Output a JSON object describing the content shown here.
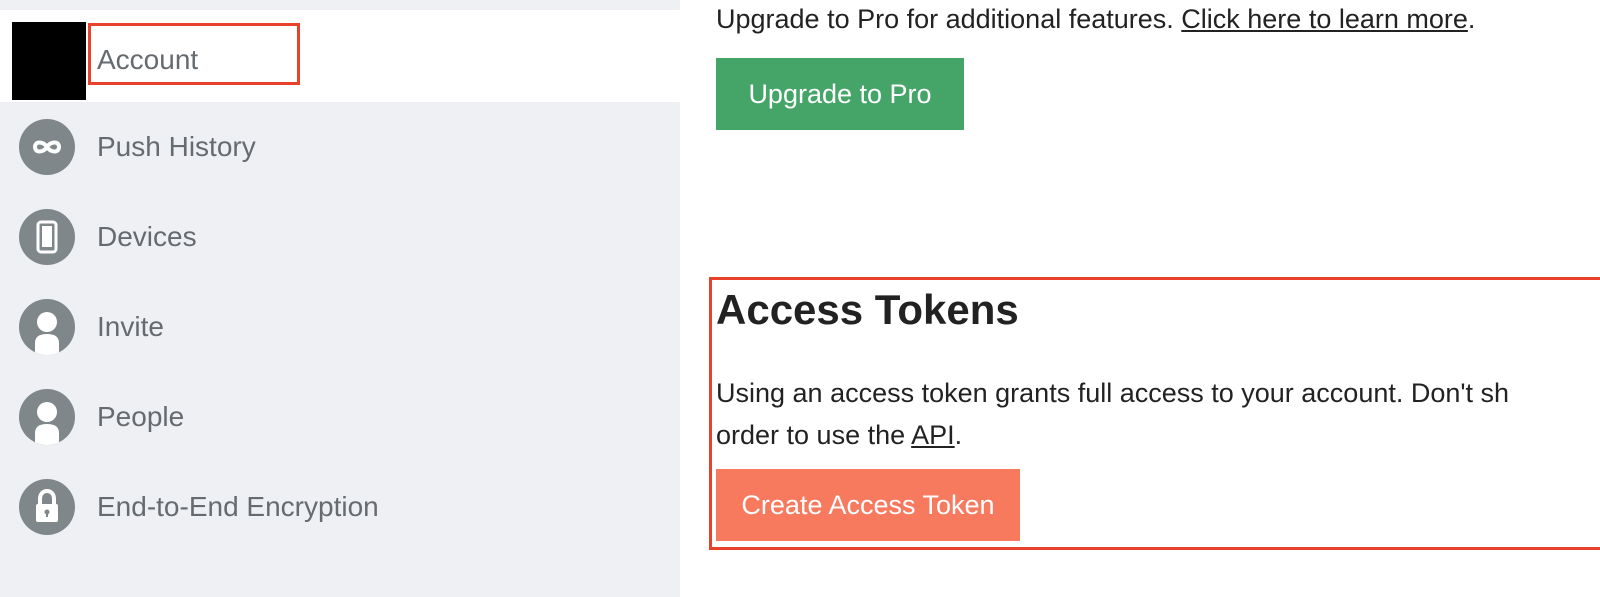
{
  "sidebar": {
    "account_label": "Account",
    "items": [
      {
        "label": "Push History",
        "icon": "infinity-icon"
      },
      {
        "label": "Devices",
        "icon": "phone-icon"
      },
      {
        "label": "Invite",
        "icon": "person-icon"
      },
      {
        "label": "People",
        "icon": "person-icon"
      },
      {
        "label": "End-to-End Encryption",
        "icon": "lock-icon"
      }
    ]
  },
  "upgrade": {
    "text": "Upgrade to Pro for additional features. ",
    "link_text": "Click here to learn more",
    "text_end": ".",
    "button_label": "Upgrade to Pro"
  },
  "tokens": {
    "title": "Access Tokens",
    "desc_line1": "Using an access token grants full access to your account. Don't sh",
    "desc_line2_pre": "order to use the ",
    "api_link": "API",
    "desc_line2_post": ".",
    "button_label": "Create Access Token"
  },
  "colors": {
    "upgrade_button": "#45a569",
    "create_button": "#f77a5f",
    "highlight": "#e8412c"
  }
}
